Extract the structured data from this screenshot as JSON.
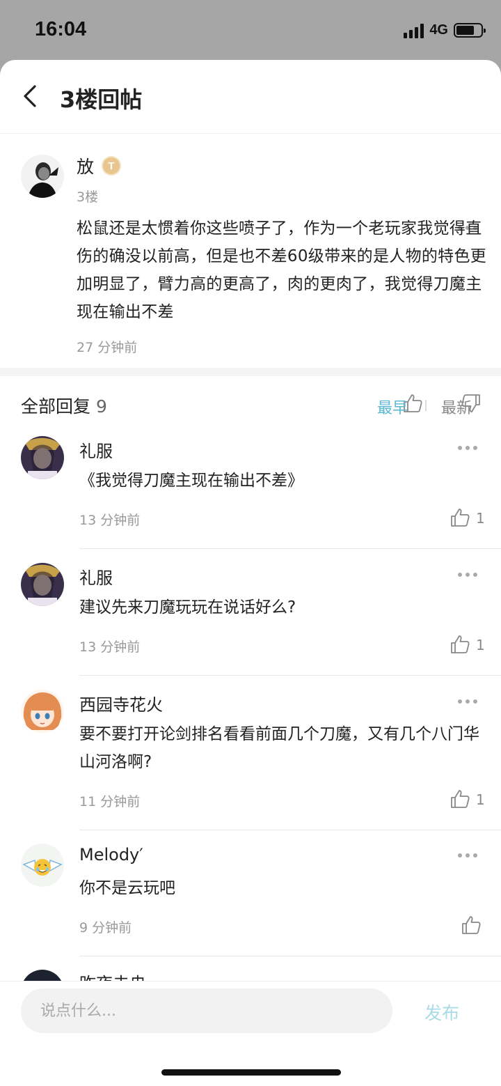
{
  "status_bar": {
    "time": "16:04",
    "network": "4G",
    "battery_level": 0.74
  },
  "nav": {
    "title": "3楼回帖"
  },
  "post": {
    "author": "放",
    "badge": "T",
    "floor": "3楼",
    "body": "松鼠还是太惯着你这些喷子了，作为一个老玩家我觉得直伤的确没以前高，但是也不差60级带来的是人物的特色更加明显了，臂力高的更高了，肉的更肉了，我觉得刀魔主现在输出不差",
    "time": "27 分钟前"
  },
  "replies_header": {
    "title": "全部回复",
    "count": "9",
    "sort_earliest": "最早",
    "sort_newest": "最新"
  },
  "replies": [
    {
      "name": "礼服",
      "text": "《我觉得刀魔主现在输出不差》",
      "time": "13 分钟前",
      "likes": "1"
    },
    {
      "name": "礼服",
      "text": "建议先来刀魔玩玩在说话好么?",
      "time": "13 分钟前",
      "likes": "1"
    },
    {
      "name": "西园寺花火",
      "text": "要不要打开论剑排名看看前面几个刀魔，又有几个八门华山河洛啊?",
      "time": "11 分钟前",
      "likes": "1"
    },
    {
      "name": "Melody′",
      "text": "你不是云玩吧",
      "time": "9 分钟前",
      "likes": ""
    },
    {
      "name": "昨夜未央"
    }
  ],
  "composer": {
    "placeholder": "说点什么...",
    "publish_label": "发布"
  },
  "colors": {
    "accent": "#5bb8d0",
    "publish_disabled": "#a9dbe7",
    "badge": "#e9c58f"
  }
}
